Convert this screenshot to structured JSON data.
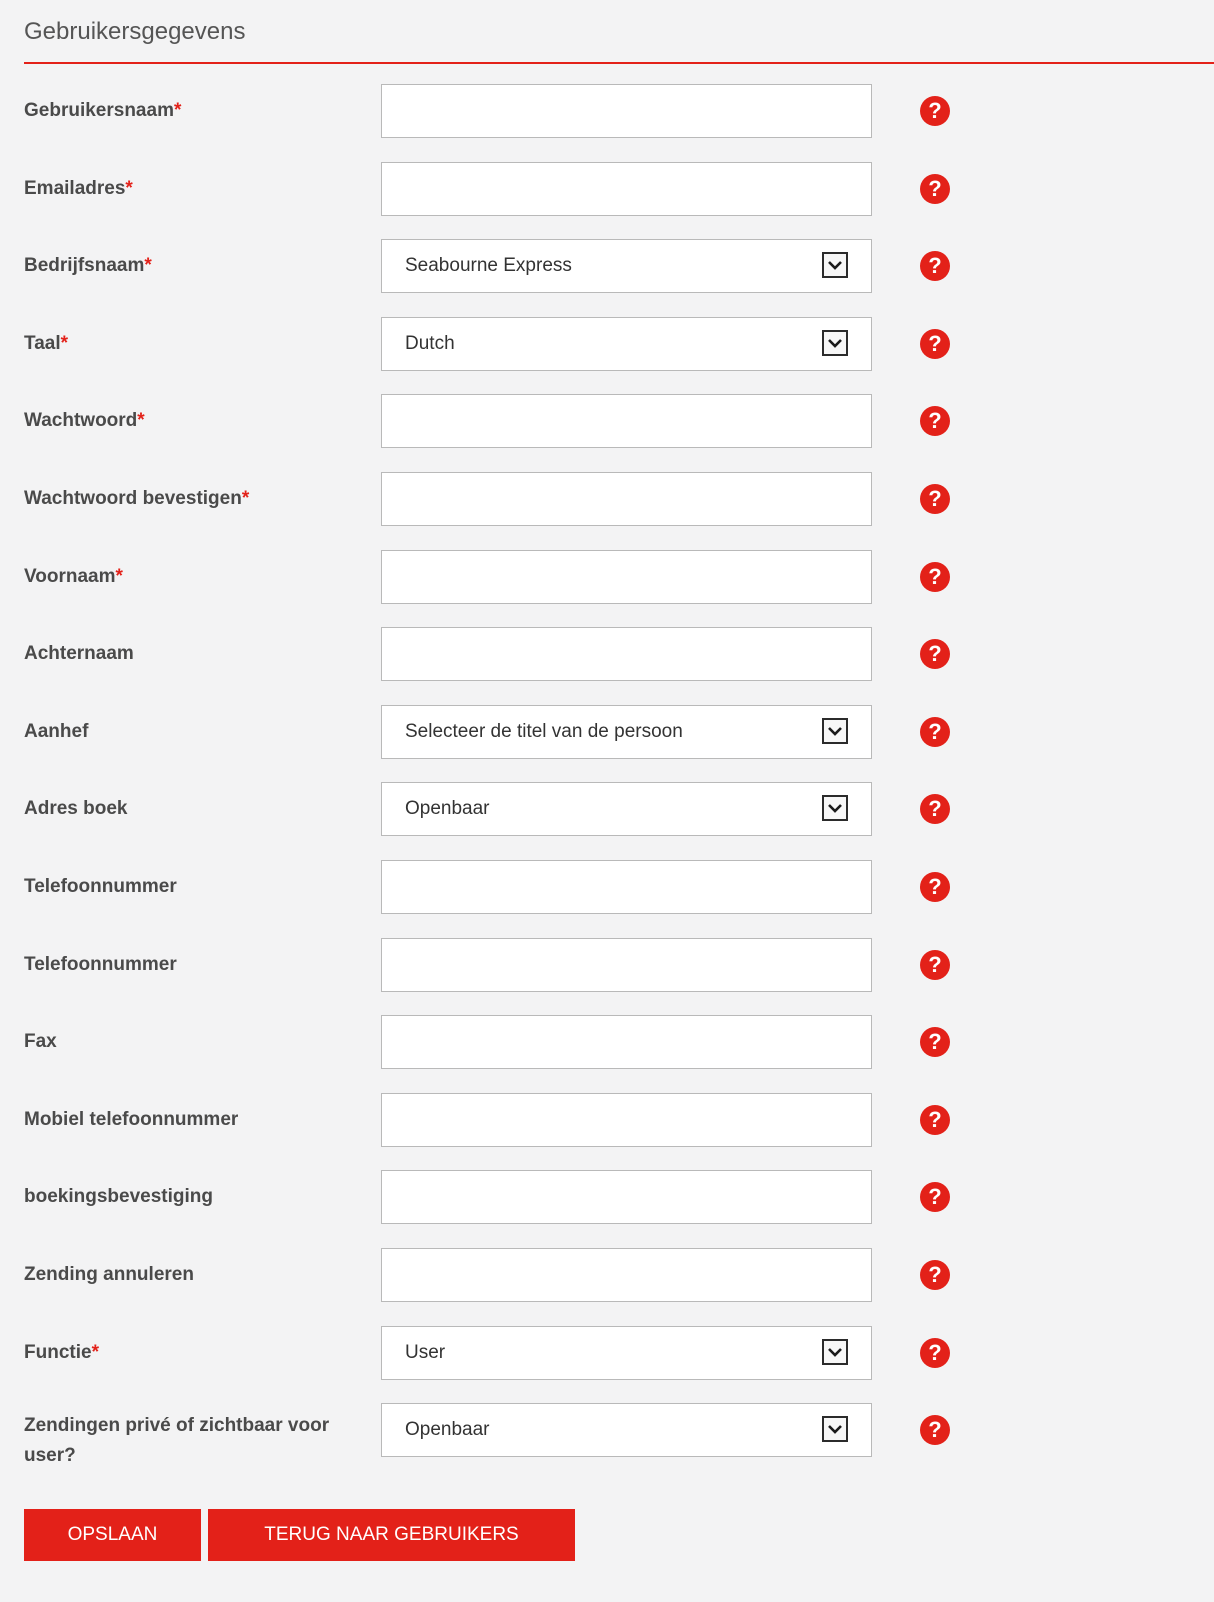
{
  "section": {
    "title": "Gebruikersgegevens"
  },
  "colors": {
    "accent": "#e32119",
    "label": "#4a4a4a",
    "border": "#b9b9b9"
  },
  "icons": {
    "help": "question-circle-icon",
    "dropdown": "chevron-down-icon"
  },
  "form": {
    "fields": [
      {
        "label": "Gebruikersnaam",
        "required": "*",
        "type": "text",
        "value": ""
      },
      {
        "label": "Emailadres",
        "required": "*",
        "type": "text",
        "value": ""
      },
      {
        "label": "Bedrijfsnaam",
        "required": "*",
        "type": "select",
        "value": "Seabourne Express"
      },
      {
        "label": "Taal",
        "required": "*",
        "type": "select",
        "value": "Dutch"
      },
      {
        "label": "Wachtwoord",
        "required": "*",
        "type": "password",
        "value": ""
      },
      {
        "label": "Wachtwoord bevestigen",
        "required": "*",
        "type": "password",
        "value": ""
      },
      {
        "label": "Voornaam",
        "required": "*",
        "type": "text",
        "value": ""
      },
      {
        "label": "Achternaam",
        "required": "",
        "type": "text",
        "value": ""
      },
      {
        "label": "Aanhef",
        "required": "",
        "type": "select",
        "value": "Selecteer de titel van de persoon"
      },
      {
        "label": "Adres boek",
        "required": "",
        "type": "select",
        "value": "Openbaar"
      },
      {
        "label": "Telefoonnummer",
        "required": "",
        "type": "text",
        "value": ""
      },
      {
        "label": "Telefoonnummer",
        "required": "",
        "type": "text",
        "value": ""
      },
      {
        "label": "Fax",
        "required": "",
        "type": "text",
        "value": ""
      },
      {
        "label": "Mobiel telefoonnummer",
        "required": "",
        "type": "text",
        "value": ""
      },
      {
        "label": "boekingsbevestiging",
        "required": "",
        "type": "text",
        "value": ""
      },
      {
        "label": "Zending annuleren",
        "required": "",
        "type": "text",
        "value": ""
      },
      {
        "label": "Functie",
        "required": "*",
        "type": "select",
        "value": "User"
      },
      {
        "label": "Zendingen privé of zichtbaar voor user?",
        "required": "",
        "type": "select",
        "value": "Openbaar"
      }
    ]
  },
  "buttons": {
    "save": "OPSLAAN",
    "back": "TERUG NAAR GEBRUIKERS"
  }
}
